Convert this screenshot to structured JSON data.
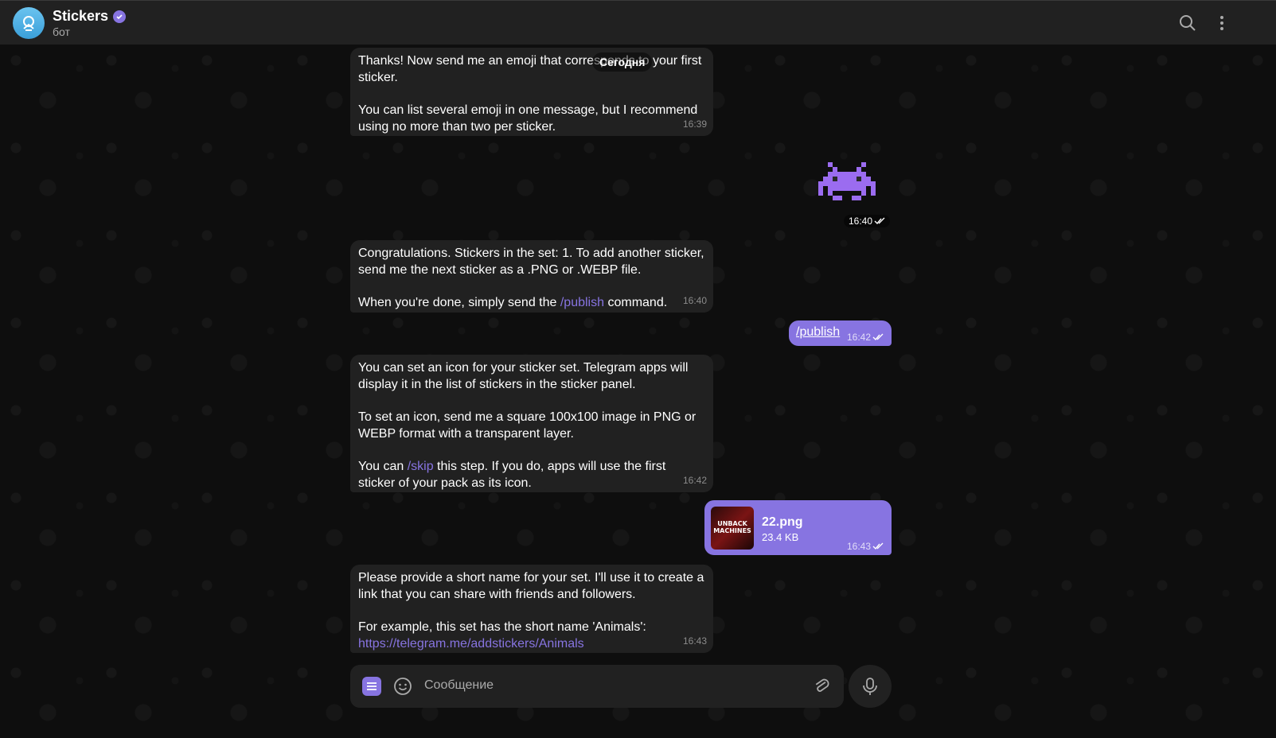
{
  "header": {
    "title": "Stickers",
    "subtitle": "бот"
  },
  "date_separator": "Сегодня",
  "messages": {
    "m1": {
      "line1": "Thanks! Now send me an emoji that corresponds to your first sticker.",
      "line2": "You can list several emoji in one message, but I recommend using no more than two per sticker.",
      "time": "16:39"
    },
    "sticker": {
      "time": "16:40",
      "emoji_name": "space-invader-sticker"
    },
    "m2": {
      "line1": "Congratulations. Stickers in the set: 1. To add another sticker, send me the next sticker as a .PNG or .WEBP file.",
      "line2_pre": "When you're done, simply send the ",
      "line2_cmd": "/publish",
      "line2_post": " command.",
      "time": "16:40"
    },
    "out1": {
      "text": "/publish",
      "time": "16:42"
    },
    "m3": {
      "line1": "You can set an icon for your sticker set. Telegram apps will display it in the list of stickers in the sticker panel.",
      "line2": "To set an icon, send me a square 100x100 image in PNG or WEBP format with a transparent layer.",
      "line3_pre": "You can ",
      "line3_cmd": "/skip",
      "line3_post": " this step. If you do, apps will use the first sticker of your pack as its icon.",
      "time": "16:42"
    },
    "out2": {
      "file_name": "22.png",
      "file_size": "23.4 KB",
      "thumb_text": "UNBACK MACHINES",
      "time": "16:43"
    },
    "m4": {
      "line1": "Please provide a short name for your set. I'll use it to create a link that you can share with friends and followers.",
      "line2": "For example, this set has the short name 'Animals':",
      "link": "https://telegram.me/addstickers/Animals",
      "time": "16:43"
    }
  },
  "composer": {
    "placeholder": "Сообщение"
  },
  "colors": {
    "accent": "#8774e1",
    "bubble_in": "#212121",
    "header": "#212121"
  }
}
